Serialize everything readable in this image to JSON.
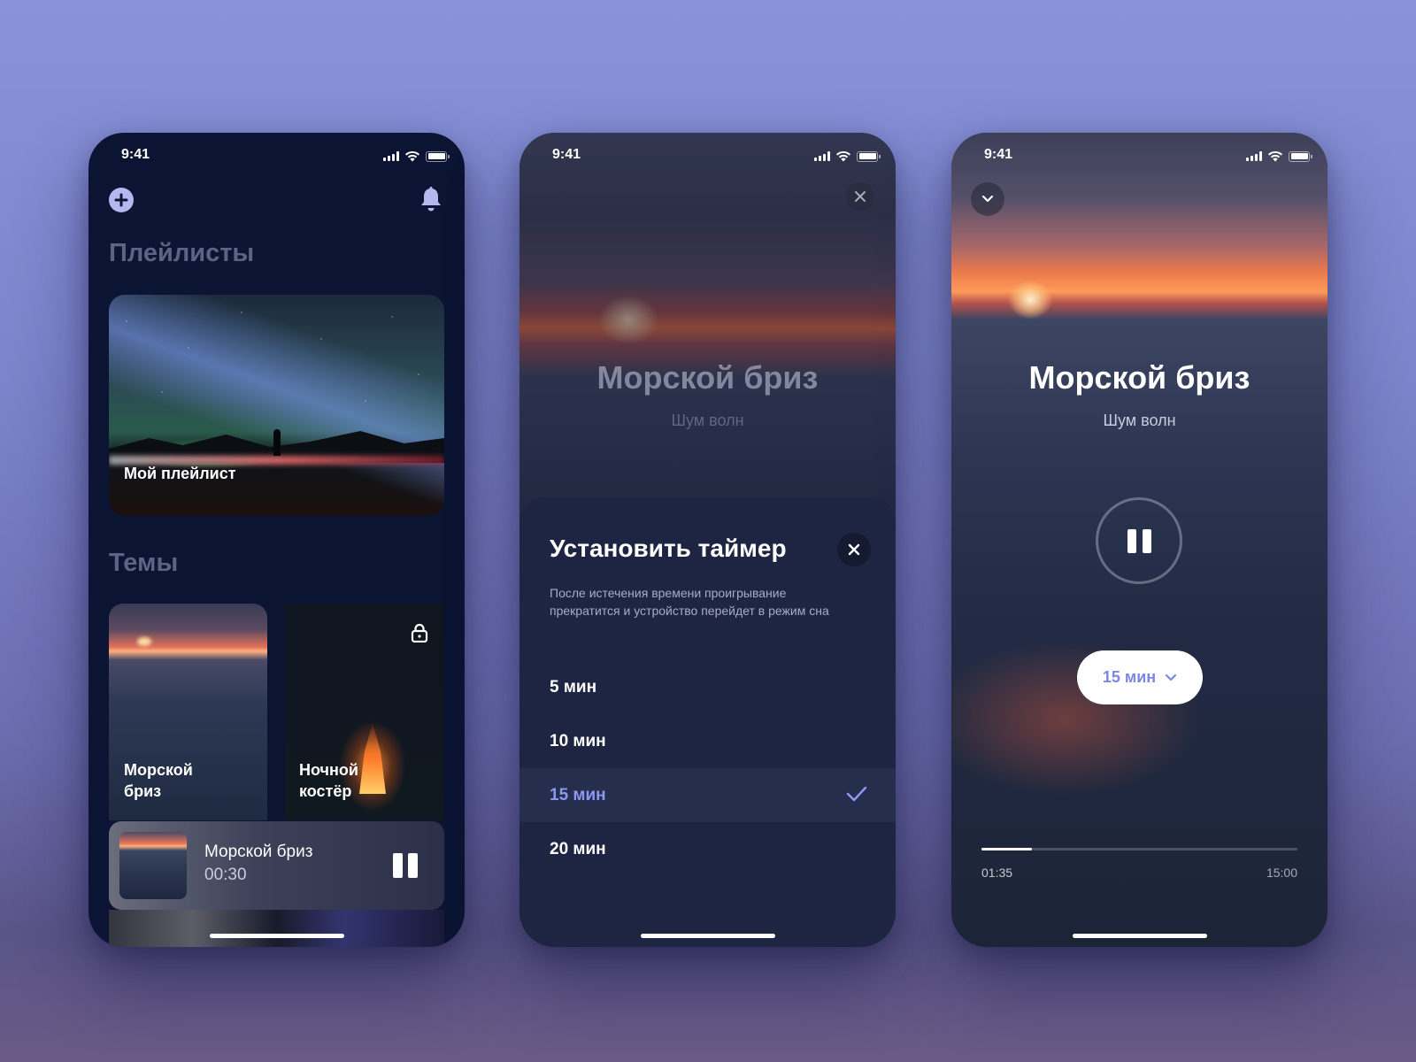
{
  "status_bar": {
    "time": "9:41"
  },
  "screen_home": {
    "section_playlists": "Плейлисты",
    "playlist_card": {
      "label": "Мой плейлист"
    },
    "section_themes": "Темы",
    "theme_cards": [
      {
        "label_line1": "Морской",
        "label_line2": "бриз",
        "locked": false
      },
      {
        "label_line1": "Ночной",
        "label_line2": "костёр",
        "locked": true
      }
    ],
    "mini_player": {
      "title": "Морской бриз",
      "time": "00:30"
    }
  },
  "screen_timer": {
    "track_title": "Морской бриз",
    "track_subtitle": "Шум волн",
    "sheet": {
      "title": "Установить таймер",
      "description": "После истечения времени проигрывание прекратится и устройство перейдет в режим сна",
      "options": [
        "5 мин",
        "10 мин",
        "15 мин",
        "20 мин"
      ],
      "selected": "15 мин"
    }
  },
  "screen_player": {
    "track_title": "Морской бриз",
    "track_subtitle": "Шум волн",
    "timer_label": "15 мин",
    "elapsed": "01:35",
    "total": "15:00",
    "progress_fraction": 0.16
  },
  "colors": {
    "accent": "#8d98f2",
    "background": "#0c1433",
    "sheet": "#1d2542"
  },
  "icons": [
    "add-icon",
    "bell-icon",
    "lock-icon",
    "pause-icon",
    "close-icon",
    "check-icon",
    "chevron-down-icon"
  ]
}
